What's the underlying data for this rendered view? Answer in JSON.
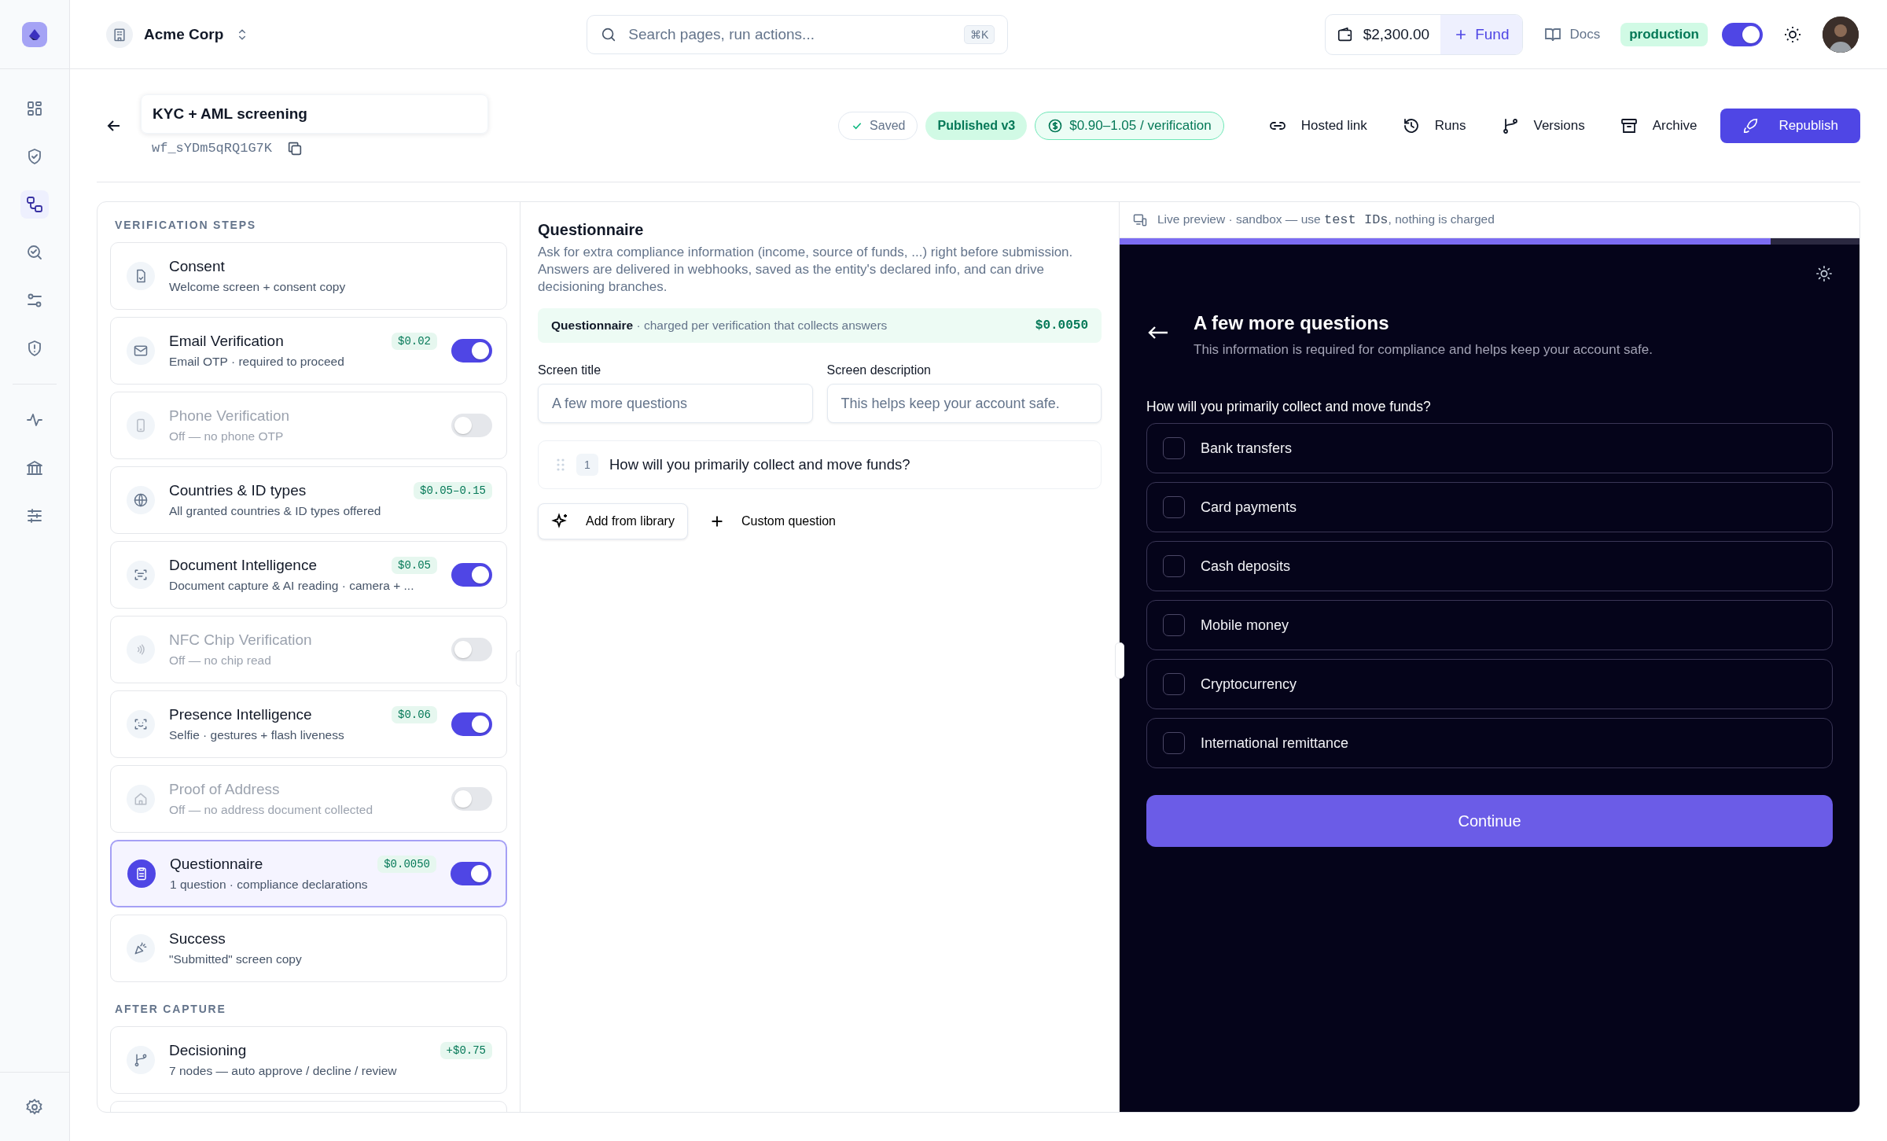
{
  "rail": {
    "items": [
      {
        "selected": false
      },
      {
        "selected": false
      },
      {
        "selected": true
      },
      {
        "selected": false
      },
      {
        "selected": false
      },
      {
        "selected": false
      },
      {
        "selected": false
      },
      {
        "selected": false
      },
      {
        "selected": false
      }
    ]
  },
  "topbar": {
    "org": "Acme Corp",
    "search": {
      "placeholder": "Search pages, run actions...",
      "shortcut": "⌘K"
    },
    "balance": "$2,300.00",
    "fund": "Fund",
    "docs": "Docs",
    "environment": "production",
    "environment_on": true
  },
  "header": {
    "title": "KYC + AML screening",
    "id": "wf_sYDm5qRQ1G7K",
    "badges": [
      {
        "kind": "saved",
        "label": "Saved"
      },
      {
        "kind": "published",
        "label": "Published v3"
      },
      {
        "kind": "price",
        "label": "$0.90–1.05 / verification"
      }
    ],
    "actions": [
      {
        "label": "Hosted link"
      },
      {
        "label": "Runs"
      },
      {
        "label": "Versions"
      },
      {
        "label": "Archive"
      }
    ],
    "primary": "Republish"
  },
  "steps": {
    "heading": "VERIFICATION STEPS",
    "items": [
      {
        "kind": "fixed",
        "title": "Consent",
        "subtitle": "Welcome screen + consent copy",
        "selected": false
      },
      {
        "kind": "toggle",
        "title": "Email Verification",
        "subtitle": "Email OTP · required to proceed",
        "price": "$0.02",
        "on": true,
        "selected": false
      },
      {
        "kind": "toggle",
        "title": "Phone Verification",
        "subtitle": "Off — no phone OTP",
        "on": false,
        "selected": false
      },
      {
        "kind": "fixed",
        "title": "Countries & ID types",
        "subtitle": "All granted countries & ID types offered",
        "price": "$0.05–0.15",
        "selected": false
      },
      {
        "kind": "toggle",
        "title": "Document Intelligence",
        "subtitle": "Document capture & AI reading · camera + ...",
        "price": "$0.05",
        "on": true,
        "selected": false
      },
      {
        "kind": "toggle",
        "title": "NFC Chip Verification",
        "subtitle": "Off — no chip read",
        "on": false,
        "selected": false
      },
      {
        "kind": "toggle",
        "title": "Presence Intelligence",
        "subtitle": "Selfie · gestures + flash liveness",
        "price": "$0.06",
        "on": true,
        "selected": false
      },
      {
        "kind": "toggle",
        "title": "Proof of Address",
        "subtitle": "Off — no address document collected",
        "on": false,
        "selected": false
      },
      {
        "kind": "toggle",
        "title": "Questionnaire",
        "subtitle": "1 question · compliance declarations",
        "price": "$0.0050",
        "on": true,
        "selected": true
      },
      {
        "kind": "fixed",
        "title": "Success",
        "subtitle": "\"Submitted\" screen copy",
        "selected": false
      }
    ]
  },
  "after_capture": {
    "heading": "AFTER CAPTURE",
    "items": [
      {
        "title": "Decisioning",
        "subtitle": "7 nodes — auto approve / decline / review",
        "price": "+$0.75"
      }
    ]
  },
  "editor": {
    "title": "Questionnaire",
    "description": "Ask for extra compliance information (income, source of funds, ...) right before submission. Answers are delivered in webhooks, saved as the entity's declared info, and can drive decisioning branches.",
    "charge": {
      "label": "Questionnaire",
      "note": "· charged per verification that collects answers",
      "price": "$0.0050"
    },
    "fields": [
      {
        "label": "Screen title",
        "placeholder": "A few more questions"
      },
      {
        "label": "Screen description",
        "placeholder": "This helps keep your account safe."
      }
    ],
    "questions": [
      {
        "number": "1",
        "text": "How will you primarily collect and move funds?"
      }
    ],
    "buttons": [
      {
        "kind": "library",
        "label": "Add from library"
      },
      {
        "kind": "custom",
        "label": "Custom question"
      }
    ]
  },
  "preview": {
    "note_before": "Live preview · sandbox — use",
    "note_code": "test IDs",
    "note_after": ", nothing is charged",
    "level": 0.88,
    "title": "A few more questions",
    "description": "This information is required for compliance and helps keep your account safe.",
    "question": "How will you primarily collect and move funds?",
    "options": [
      {
        "label": "Bank transfers",
        "checked": false
      },
      {
        "label": "Card payments",
        "checked": false
      },
      {
        "label": "Cash deposits",
        "checked": false
      },
      {
        "label": "Mobile money",
        "checked": false
      },
      {
        "label": "Cryptocurrency",
        "checked": false
      },
      {
        "label": "International remittance",
        "checked": false
      }
    ],
    "button": "Continue"
  }
}
